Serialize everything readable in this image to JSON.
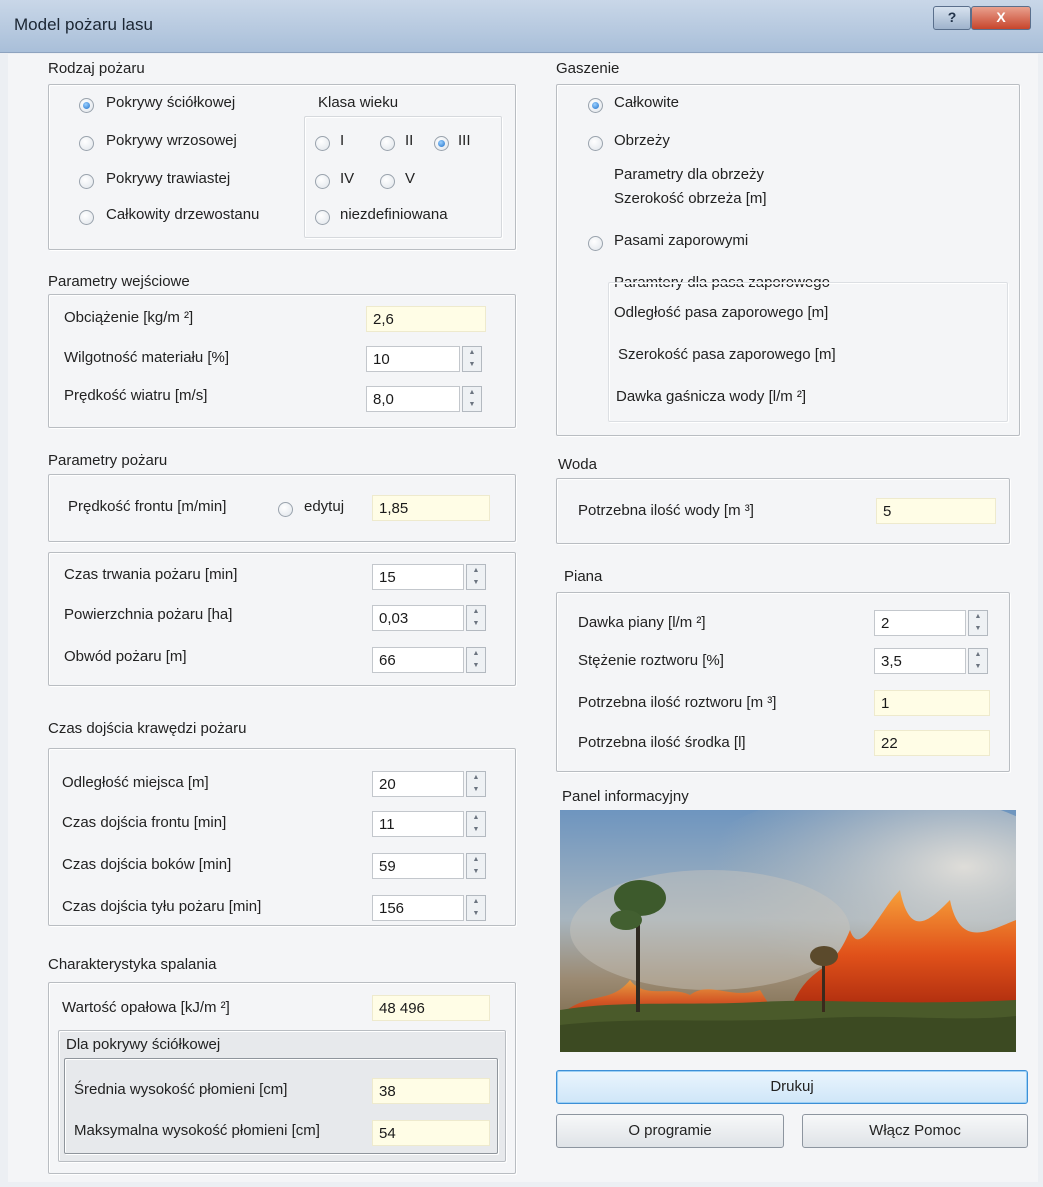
{
  "window": {
    "title": "Model pożaru lasu",
    "help_label": "?",
    "close_label": "X"
  },
  "rodzaj": {
    "label": "Rodzaj pożaru",
    "options": [
      "Pokrywy ściółkowej",
      "Pokrywy wrzosowej",
      "Pokrywy trawiastej",
      "Całkowity drzewostanu"
    ],
    "selected": "Pokrywy ściółkowej",
    "klasa": {
      "label": "Klasa wieku",
      "options": [
        "I",
        "II",
        "III",
        "IV",
        "V",
        "niezdefiniowana"
      ],
      "selected": "III"
    }
  },
  "wejsciowe": {
    "label": "Parametry wejściowe",
    "obciazenie": {
      "label": "Obciążenie [kg/m ²]",
      "value": "2,6"
    },
    "wilgotnosc": {
      "label": "Wilgotność materiału [%]",
      "value": "10"
    },
    "wiatr": {
      "label": "Prędkość wiatru [m/s]",
      "value": "8,0"
    }
  },
  "pozar": {
    "label": "Parametry pożaru",
    "front": {
      "label": "Prędkość frontu [m/min]",
      "edit_label": "edytuj",
      "value": "1,85"
    },
    "czas": {
      "label": "Czas trwania pożaru [min]",
      "value": "15"
    },
    "powierzchnia": {
      "label": "Powierzchnia pożaru [ha]",
      "value": "0,03"
    },
    "obwod": {
      "label": "Obwód pożaru [m]",
      "value": "66"
    }
  },
  "dojscie": {
    "label": "Czas dojścia krawędzi pożaru",
    "odleglosc": {
      "label": "Odległość miejsca [m]",
      "value": "20"
    },
    "frontu": {
      "label": "Czas dojścia frontu [min]",
      "value": "11"
    },
    "bokow": {
      "label": "Czas dojścia  boków [min]",
      "value": "59"
    },
    "tylu": {
      "label": "Czas dojścia tyłu pożaru [min]",
      "value": "156"
    }
  },
  "spalanie": {
    "label": "Charakterystyka spalania",
    "opalowa": {
      "label": "Wartość opałowa [kJ/m ²]",
      "value": "48 496"
    },
    "sub_label": "Dla pokrywy ściółkowej",
    "srednia": {
      "label": "Średnia wysokość płomieni [cm]",
      "value": "38"
    },
    "maks": {
      "label": "Maksymalna wysokość płomieni [cm]",
      "value": "54"
    }
  },
  "gaszenie": {
    "label": "Gaszenie",
    "calkowite": "Całkowite",
    "obrzeza": "Obrzeży",
    "selected": "Całkowite",
    "obrzeza_params": "Parametry dla obrzeży",
    "obrzeza_szer": "Szerokość obrzeża [m]",
    "pasy": "Pasami zaporowymi",
    "pasy_params": "Paramtery dla pasa zaporowego",
    "pasy_odl": "Odległość pasa zaporowego [m]",
    "pasy_szer": "Szerokość pasa zaporowego  [m]",
    "pasy_dawka": "Dawka gaśnicza wody [l/m ²]"
  },
  "woda": {
    "label": "Woda",
    "ilosc": {
      "label": "Potrzebna ilość wody [m ³]",
      "value": "5"
    }
  },
  "piana": {
    "label": "Piana",
    "dawka": {
      "label": "Dawka piany [l/m ²]",
      "value": "2"
    },
    "stezenie": {
      "label": "Stężenie roztworu [%]",
      "value": "3,5"
    },
    "roztwor": {
      "label": "Potrzebna ilość roztworu [m ³]",
      "value": "1"
    },
    "srodek": {
      "label": "Potrzebna ilość środka [l]",
      "value": "22"
    }
  },
  "panel": {
    "label": "Panel informacyjny"
  },
  "buttons": {
    "drukuj": "Drukuj",
    "oprogramie": "O programie",
    "pomoc": "Włącz Pomoc"
  },
  "icons": {
    "spin_up": "▲",
    "spin_down": "▼"
  }
}
